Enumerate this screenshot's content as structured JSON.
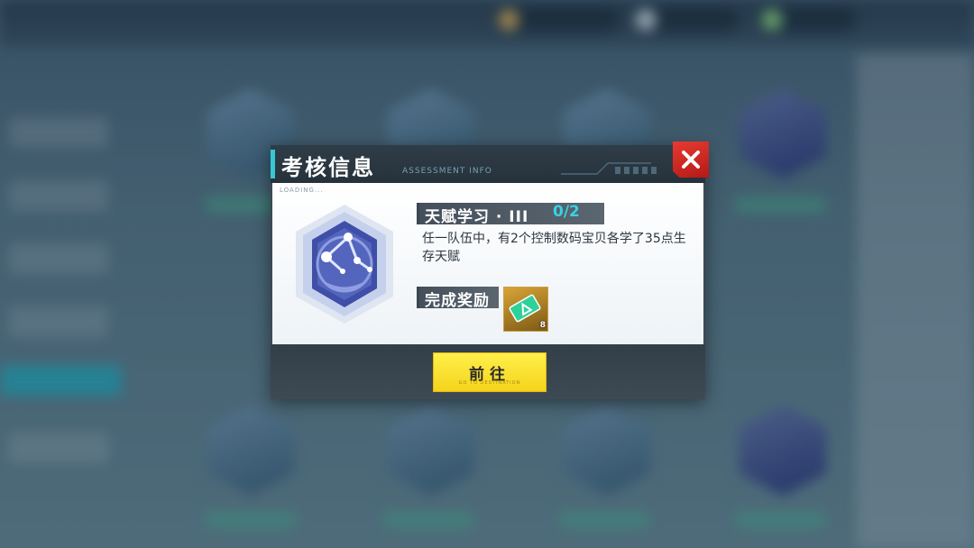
{
  "dialog": {
    "title": "考核信息",
    "subtitle": "ASSESSMENT INFO",
    "loading_label": "LOADING...",
    "close_icon": "close-x-icon",
    "task": {
      "name": "天赋学习 · III",
      "progress": "0/2",
      "description": "任一队伍中，有2个控制数码宝贝各学了35点生存天赋"
    },
    "reward": {
      "label": "完成奖励",
      "item_icon": "ticket-icon",
      "count": "8"
    },
    "go_button": {
      "label": "前往",
      "sub": "GO TO DESTINATION"
    }
  },
  "colors": {
    "accent_cyan": "#37c6d6",
    "close_red": "#e83a32",
    "button_yellow": "#f5d31c",
    "progress_cyan": "#38d2e4"
  }
}
